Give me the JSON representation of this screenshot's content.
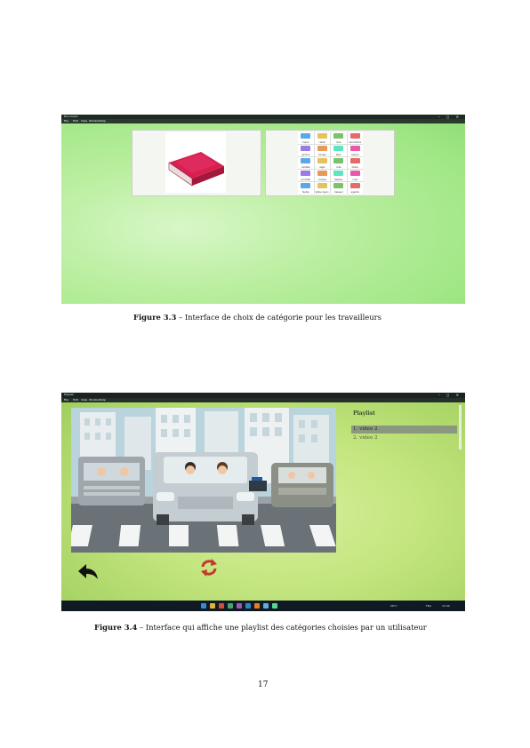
{
  "figure_3_3": {
    "window": {
      "title": "Document",
      "menu": [
        "File",
        "Edit",
        "View",
        "Window",
        "Help"
      ],
      "controls": "–  ◻  ✕"
    },
    "grid_labels": [
      "crayon",
      "cahier",
      "livre",
      "calculatrice",
      "gomme",
      "trousse",
      "stylo",
      "ciseaux",
      "cartable",
      "règle",
      "colle",
      "feutre",
      "pochette",
      "compas",
      "tableau",
      "craie",
      "feuille",
      "taille-crayon",
      "classeur",
      "agenda"
    ],
    "caption": {
      "label": "Figure 3.3",
      "text": " – Interface de choix de catégorie pour les travailleurs"
    }
  },
  "figure_3_4": {
    "window": {
      "title": "Playlist",
      "menu": [
        "File",
        "Edit",
        "View",
        "Window",
        "Help"
      ],
      "controls": "–  ◻  ✕"
    },
    "playlist": {
      "title": "Playlist",
      "items": [
        "1. video 2",
        "2. video 2"
      ]
    },
    "taskbar": {
      "weather": "26°C",
      "lang": "FRA",
      "time": "13:44"
    },
    "caption": {
      "label": "Figure 3.4",
      "text": " – Interface qui affiche une playlist des catégories choisies par un utilisateur"
    }
  },
  "page_number": "17",
  "colors": {
    "book_red": "#d81f4f",
    "refresh_icon": "#c23a2e",
    "playlist_selected": "#8a9880"
  }
}
